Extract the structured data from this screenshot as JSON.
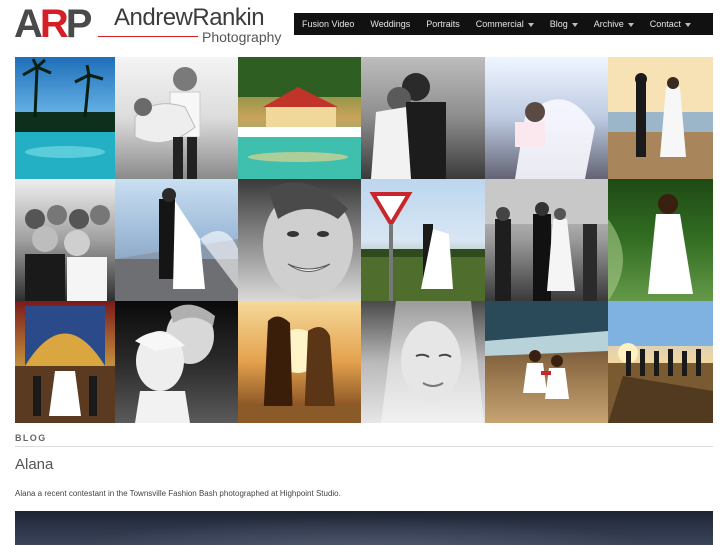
{
  "brand": {
    "mark_a": "A",
    "mark_r": "R",
    "mark_p": "P",
    "name": "AndrewRankin",
    "sub": "Photography",
    "accent_color": "#d41f26"
  },
  "nav": {
    "items": [
      {
        "label": "Fusion Video",
        "dropdown": false
      },
      {
        "label": "Weddings",
        "dropdown": false
      },
      {
        "label": "Portraits",
        "dropdown": false
      },
      {
        "label": "Commercial",
        "dropdown": true
      },
      {
        "label": "Blog",
        "dropdown": true
      },
      {
        "label": "Archive",
        "dropdown": true
      },
      {
        "label": "Contact",
        "dropdown": true
      }
    ]
  },
  "gallery": {
    "rows": 3,
    "columns": 6,
    "photos": [
      {
        "subject": "resort pool with palm trees"
      },
      {
        "subject": "groom carrying bride, black and white"
      },
      {
        "subject": "outdoor reception by pool"
      },
      {
        "subject": "couple embracing, black and white"
      },
      {
        "subject": "bride with child"
      },
      {
        "subject": "couple on beach at sunset"
      },
      {
        "subject": "wedding party group"
      },
      {
        "subject": "couple kissing on jetty"
      },
      {
        "subject": "smiling woman close-up"
      },
      {
        "subject": "couple by give way sign"
      },
      {
        "subject": "wedding procession"
      },
      {
        "subject": "bride in field"
      },
      {
        "subject": "church ceremony"
      },
      {
        "subject": "couple close-up, black and white"
      },
      {
        "subject": "couple in sun flare"
      },
      {
        "subject": "veiled bride portrait"
      },
      {
        "subject": "flower girls on beach"
      },
      {
        "subject": "group silhouettes at sunset"
      }
    ]
  },
  "blog": {
    "section_label": "BLOG",
    "post_title": "Alana",
    "post_excerpt": "Alana a recent contestant in the Townsville Fashion Bash photographed at Highpoint Studio."
  }
}
